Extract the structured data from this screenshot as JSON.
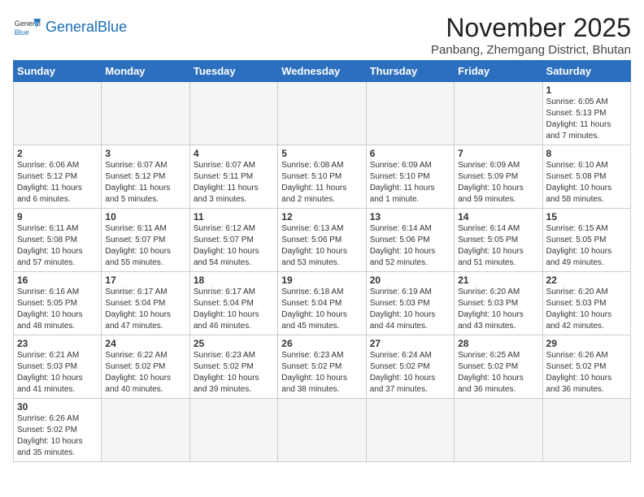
{
  "header": {
    "logo_general": "General",
    "logo_blue": "Blue",
    "month_title": "November 2025",
    "subtitle": "Panbang, Zhemgang District, Bhutan"
  },
  "days_of_week": [
    "Sunday",
    "Monday",
    "Tuesday",
    "Wednesday",
    "Thursday",
    "Friday",
    "Saturday"
  ],
  "weeks": [
    [
      {
        "day": "",
        "info": ""
      },
      {
        "day": "",
        "info": ""
      },
      {
        "day": "",
        "info": ""
      },
      {
        "day": "",
        "info": ""
      },
      {
        "day": "",
        "info": ""
      },
      {
        "day": "",
        "info": ""
      },
      {
        "day": "1",
        "info": "Sunrise: 6:05 AM\nSunset: 5:13 PM\nDaylight: 11 hours\nand 7 minutes."
      }
    ],
    [
      {
        "day": "2",
        "info": "Sunrise: 6:06 AM\nSunset: 5:12 PM\nDaylight: 11 hours\nand 6 minutes."
      },
      {
        "day": "3",
        "info": "Sunrise: 6:07 AM\nSunset: 5:12 PM\nDaylight: 11 hours\nand 5 minutes."
      },
      {
        "day": "4",
        "info": "Sunrise: 6:07 AM\nSunset: 5:11 PM\nDaylight: 11 hours\nand 3 minutes."
      },
      {
        "day": "5",
        "info": "Sunrise: 6:08 AM\nSunset: 5:10 PM\nDaylight: 11 hours\nand 2 minutes."
      },
      {
        "day": "6",
        "info": "Sunrise: 6:09 AM\nSunset: 5:10 PM\nDaylight: 11 hours\nand 1 minute."
      },
      {
        "day": "7",
        "info": "Sunrise: 6:09 AM\nSunset: 5:09 PM\nDaylight: 10 hours\nand 59 minutes."
      },
      {
        "day": "8",
        "info": "Sunrise: 6:10 AM\nSunset: 5:08 PM\nDaylight: 10 hours\nand 58 minutes."
      }
    ],
    [
      {
        "day": "9",
        "info": "Sunrise: 6:11 AM\nSunset: 5:08 PM\nDaylight: 10 hours\nand 57 minutes."
      },
      {
        "day": "10",
        "info": "Sunrise: 6:11 AM\nSunset: 5:07 PM\nDaylight: 10 hours\nand 55 minutes."
      },
      {
        "day": "11",
        "info": "Sunrise: 6:12 AM\nSunset: 5:07 PM\nDaylight: 10 hours\nand 54 minutes."
      },
      {
        "day": "12",
        "info": "Sunrise: 6:13 AM\nSunset: 5:06 PM\nDaylight: 10 hours\nand 53 minutes."
      },
      {
        "day": "13",
        "info": "Sunrise: 6:14 AM\nSunset: 5:06 PM\nDaylight: 10 hours\nand 52 minutes."
      },
      {
        "day": "14",
        "info": "Sunrise: 6:14 AM\nSunset: 5:05 PM\nDaylight: 10 hours\nand 51 minutes."
      },
      {
        "day": "15",
        "info": "Sunrise: 6:15 AM\nSunset: 5:05 PM\nDaylight: 10 hours\nand 49 minutes."
      }
    ],
    [
      {
        "day": "16",
        "info": "Sunrise: 6:16 AM\nSunset: 5:05 PM\nDaylight: 10 hours\nand 48 minutes."
      },
      {
        "day": "17",
        "info": "Sunrise: 6:17 AM\nSunset: 5:04 PM\nDaylight: 10 hours\nand 47 minutes."
      },
      {
        "day": "18",
        "info": "Sunrise: 6:17 AM\nSunset: 5:04 PM\nDaylight: 10 hours\nand 46 minutes."
      },
      {
        "day": "19",
        "info": "Sunrise: 6:18 AM\nSunset: 5:04 PM\nDaylight: 10 hours\nand 45 minutes."
      },
      {
        "day": "20",
        "info": "Sunrise: 6:19 AM\nSunset: 5:03 PM\nDaylight: 10 hours\nand 44 minutes."
      },
      {
        "day": "21",
        "info": "Sunrise: 6:20 AM\nSunset: 5:03 PM\nDaylight: 10 hours\nand 43 minutes."
      },
      {
        "day": "22",
        "info": "Sunrise: 6:20 AM\nSunset: 5:03 PM\nDaylight: 10 hours\nand 42 minutes."
      }
    ],
    [
      {
        "day": "23",
        "info": "Sunrise: 6:21 AM\nSunset: 5:03 PM\nDaylight: 10 hours\nand 41 minutes."
      },
      {
        "day": "24",
        "info": "Sunrise: 6:22 AM\nSunset: 5:02 PM\nDaylight: 10 hours\nand 40 minutes."
      },
      {
        "day": "25",
        "info": "Sunrise: 6:23 AM\nSunset: 5:02 PM\nDaylight: 10 hours\nand 39 minutes."
      },
      {
        "day": "26",
        "info": "Sunrise: 6:23 AM\nSunset: 5:02 PM\nDaylight: 10 hours\nand 38 minutes."
      },
      {
        "day": "27",
        "info": "Sunrise: 6:24 AM\nSunset: 5:02 PM\nDaylight: 10 hours\nand 37 minutes."
      },
      {
        "day": "28",
        "info": "Sunrise: 6:25 AM\nSunset: 5:02 PM\nDaylight: 10 hours\nand 36 minutes."
      },
      {
        "day": "29",
        "info": "Sunrise: 6:26 AM\nSunset: 5:02 PM\nDaylight: 10 hours\nand 36 minutes."
      }
    ],
    [
      {
        "day": "30",
        "info": "Sunrise: 6:26 AM\nSunset: 5:02 PM\nDaylight: 10 hours\nand 35 minutes."
      },
      {
        "day": "",
        "info": ""
      },
      {
        "day": "",
        "info": ""
      },
      {
        "day": "",
        "info": ""
      },
      {
        "day": "",
        "info": ""
      },
      {
        "day": "",
        "info": ""
      },
      {
        "day": "",
        "info": ""
      }
    ]
  ]
}
